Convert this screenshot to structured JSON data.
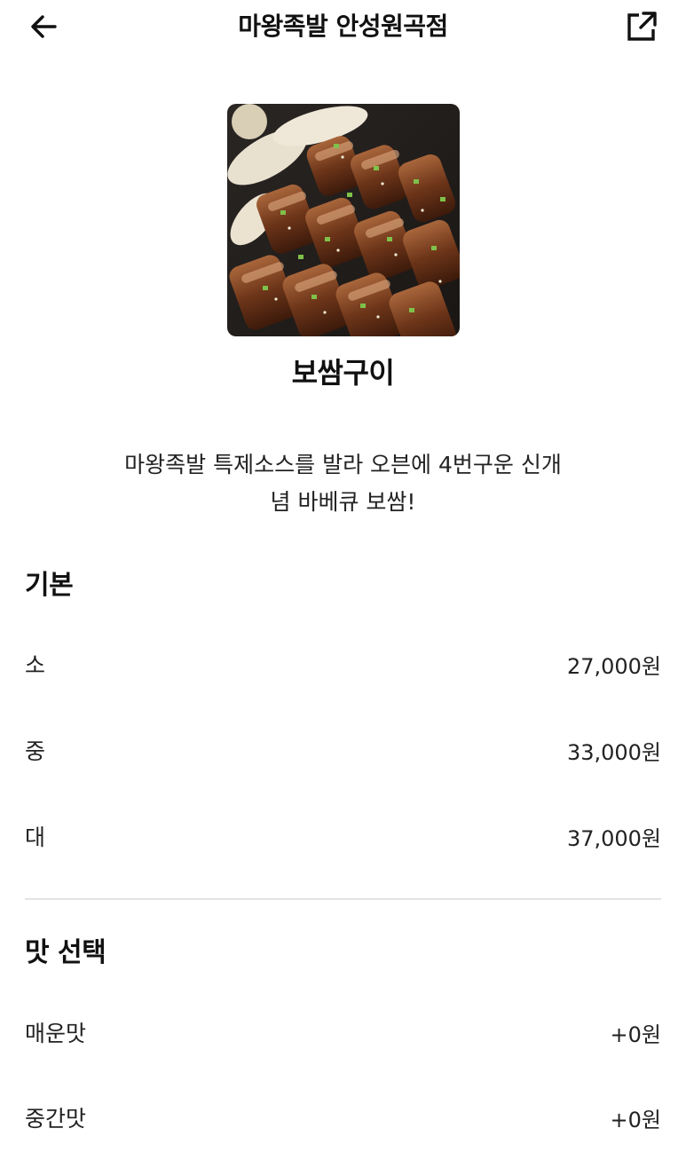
{
  "header": {
    "title": "마왕족발 안성원곡점",
    "back_icon": "arrow-left-icon",
    "share_icon": "share-external-icon"
  },
  "menu": {
    "name": "보쌈구이",
    "description_line1": "마왕족발 특제소스를 발라 오븐에 4번구운 신개",
    "description_line2": "념 바베큐 보쌈!"
  },
  "sections": {
    "basic": {
      "title": "기본",
      "options": [
        {
          "label": "소",
          "price": "27,000원"
        },
        {
          "label": "중",
          "price": "33,000원"
        },
        {
          "label": "대",
          "price": "37,000원"
        }
      ]
    },
    "taste": {
      "title": "맛 선택",
      "options": [
        {
          "label": "매운맛",
          "price": "+0원"
        },
        {
          "label": "중간맛",
          "price": "+0원"
        }
      ]
    }
  }
}
